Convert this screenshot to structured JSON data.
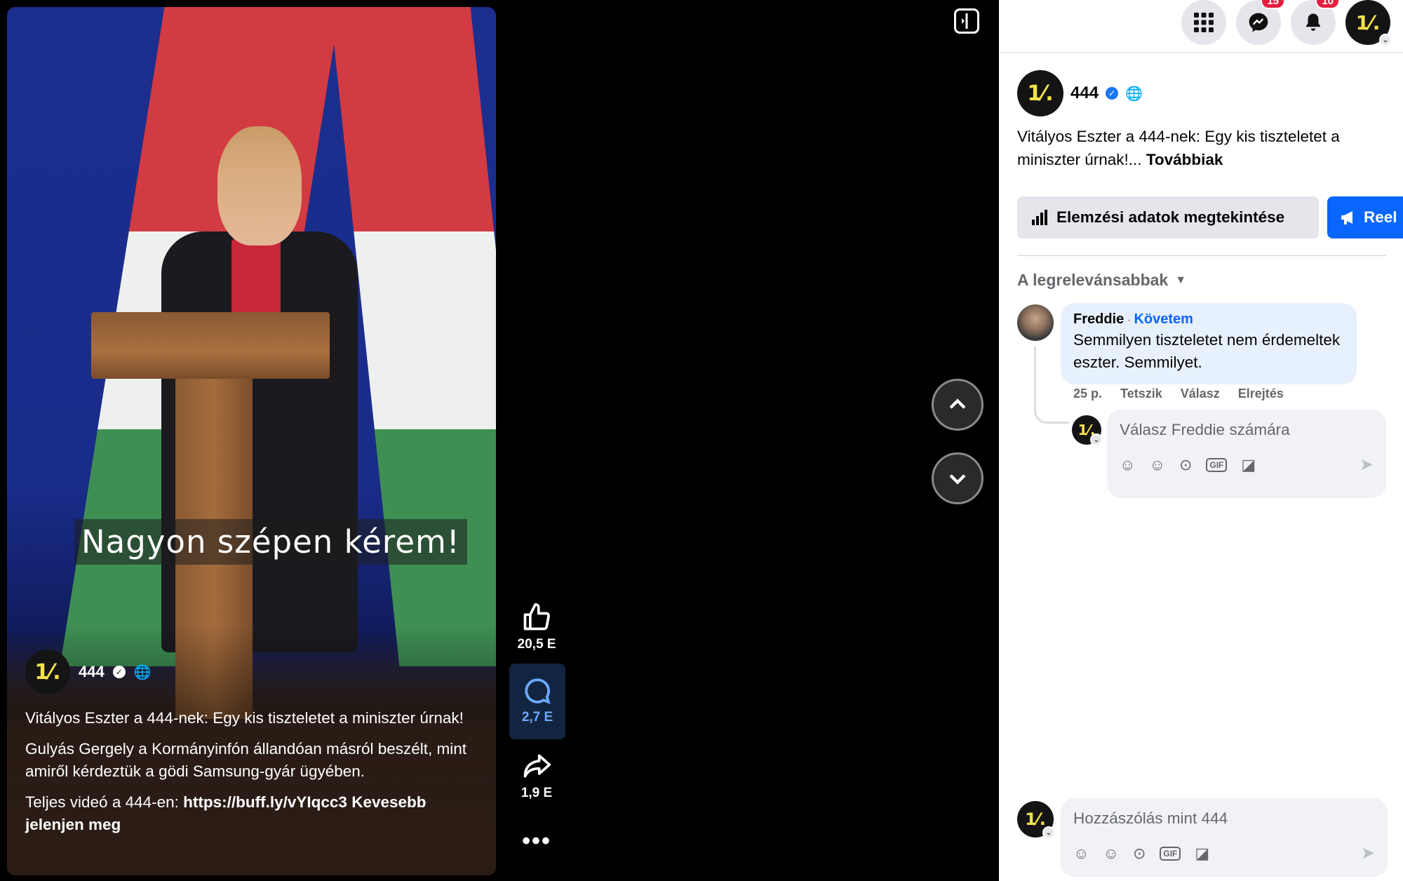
{
  "video": {
    "subtitle": "Nagyon szépen kérem!",
    "author": {
      "logo_text": "1⁄.",
      "name": "444"
    },
    "description": {
      "title": "Vitályos Eszter a 444-nek: Egy kis tiszteletet a miniszter úrnak!",
      "body": "Gulyás Gergely a Kormányinfón állandóan másról beszélt, mint amiről kérdeztük a gödi Samsung-gyár ügyében.",
      "link_prefix": "Teljes videó a 444-en: ",
      "link": "https://buff.ly/vYIqcc3",
      "less_label": " Kevesebb jelenjen meg"
    }
  },
  "actions": {
    "like_count": "20,5 E",
    "comment_count": "2,7 E",
    "share_count": "1,9 E",
    "more_label": "•••"
  },
  "icons": {
    "grid": "menu-grid-icon",
    "messenger": "messenger-icon",
    "bell": "notifications-icon",
    "verified": "verified-icon",
    "globe": "globe-icon"
  },
  "topbar": {
    "messenger_badge": "15",
    "notifications_badge": "10",
    "account_logo": "1⁄."
  },
  "post": {
    "logo_text": "1⁄.",
    "name": "444",
    "text": "Vitályos Eszter a 444-nek: Egy kis tiszteletet a miniszter úrnak!...",
    "more_label": " Továbbiak",
    "stats_button": "Elemzési adatok megtekintése",
    "reel_button": "Reel"
  },
  "comments": {
    "sort_label": "A legrelevánsabbak",
    "items": [
      {
        "author": "Freddie",
        "follow_label": "Követem",
        "text": "Semmilyen tiszteletet nem érdemeltek eszter. Semmilyet.",
        "time": "25 p.",
        "like_label": "Tetszik",
        "reply_label": "Válasz",
        "hide_label": "Elrejtés"
      }
    ],
    "reply_placeholder": "Válasz Freddie számára",
    "comment_placeholder": "Hozzászólás mint 444"
  },
  "colors": {
    "accent": "#0866ff",
    "logo_yellow": "#f4e34a",
    "badge_red": "#e41e3f",
    "comment_bubble": "#e7f0fd"
  }
}
